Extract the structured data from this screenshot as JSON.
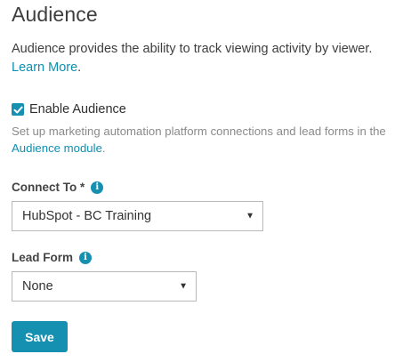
{
  "title": "Audience",
  "description": {
    "text": "Audience provides the ability to track viewing activity by viewer.",
    "learn_more": "Learn More",
    "period": "."
  },
  "enable_checkbox": {
    "label": "Enable Audience",
    "checked": true
  },
  "helper": {
    "text": "Set up marketing automation platform connections and lead forms in the",
    "link": "Audience module",
    "period": "."
  },
  "connect_to": {
    "label": "Connect To *",
    "value": "HubSpot - BC Training",
    "info_icon": "info-icon"
  },
  "lead_form": {
    "label": "Lead Form",
    "value": "None",
    "info_icon": "info-icon"
  },
  "save_label": "Save",
  "colors": {
    "accent": "#1590b0",
    "link": "#0f8fb0"
  }
}
